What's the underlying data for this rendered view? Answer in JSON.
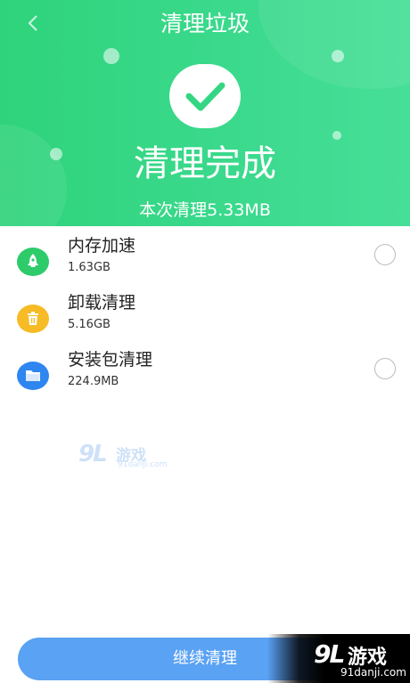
{
  "header": {
    "title": "清理垃圾",
    "back_icon": "chevron-left-icon",
    "result_title": "清理完成",
    "summary": "本次清理5.33MB",
    "bg_color": "#3ad98c"
  },
  "items": [
    {
      "name": "内存加速",
      "size": "1.63GB",
      "icon": "rocket-icon",
      "color": "#2ecb6a",
      "has_radio": true
    },
    {
      "name": "卸载清理",
      "size": "5.16GB",
      "icon": "trash-icon",
      "color": "#f6bb25",
      "has_radio": false
    },
    {
      "name": "安装包清理",
      "size": "224.9MB",
      "icon": "folder-icon",
      "color": "#2f86f0",
      "has_radio": true
    }
  ],
  "continue_button": {
    "label": "继续清理",
    "color": "#5aa2f3"
  },
  "watermark": {
    "logo": "9L",
    "text": "游戏",
    "url": "91danji.com"
  }
}
